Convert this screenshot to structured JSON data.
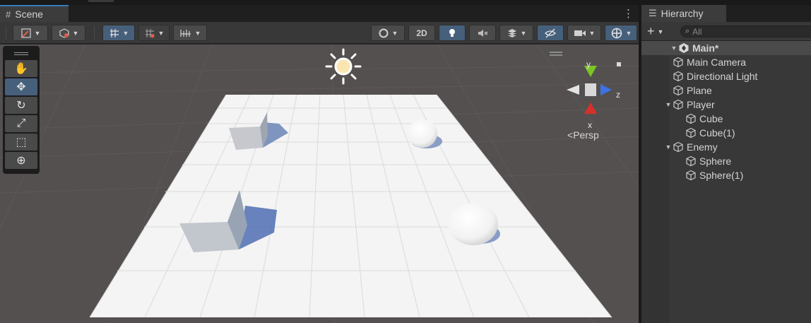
{
  "scene_tab": {
    "label": "Scene",
    "icon": "grid-icon"
  },
  "scene_toolbar": {
    "btn_2d": "2D",
    "icons": [
      "draw-mode-icon",
      "shading-icon",
      "grid-snap-icon",
      "increment-snap-icon",
      "ruler-icon",
      "orbit-icon",
      "lighting-icon",
      "audio-mute-icon",
      "effects-icon",
      "hidden-objects-icon",
      "camera-icon",
      "gizmos-icon"
    ]
  },
  "tools": [
    "hand-tool",
    "move-tool",
    "rotate-tool",
    "scale-tool",
    "rect-tool",
    "transform-tool"
  ],
  "active_tool": "move-tool",
  "gizmo": {
    "x": "x",
    "y": "y",
    "z": "z",
    "projection": "Persp"
  },
  "hierarchy": {
    "tab_label": "Hierarchy",
    "search_placeholder": "All",
    "root": "Main*",
    "items": [
      {
        "label": "Main Camera",
        "depth": 1
      },
      {
        "label": "Directional Light",
        "depth": 1
      },
      {
        "label": "Plane",
        "depth": 1
      },
      {
        "label": "Player",
        "depth": 1,
        "expanded": true
      },
      {
        "label": "Cube",
        "depth": 2
      },
      {
        "label": "Cube(1)",
        "depth": 2
      },
      {
        "label": "Enemy",
        "depth": 1,
        "expanded": true
      },
      {
        "label": "Sphere",
        "depth": 2
      },
      {
        "label": "Sphere(1)",
        "depth": 2
      }
    ]
  },
  "colors": {
    "accent": "#46607c",
    "tab_highlight": "#3a79bb",
    "gizmo_x": "#d6302a",
    "gizmo_y": "#7cc424",
    "gizmo_z": "#3c72e6"
  }
}
